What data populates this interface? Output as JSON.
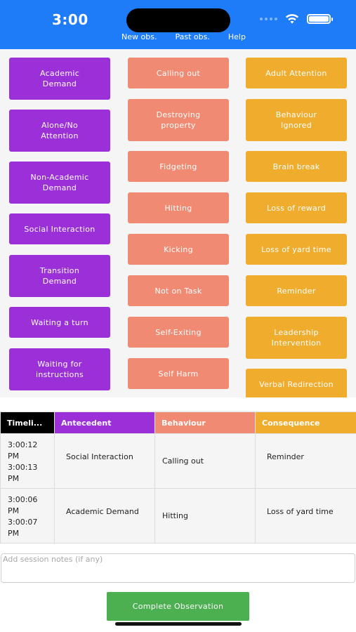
{
  "status": {
    "time": "3:00"
  },
  "nav": [
    "New obs.",
    "Past obs.",
    "Help"
  ],
  "antecedents": [
    "Academic\nDemand",
    "Alone/No\nAttention",
    "Non-Academic\nDemand",
    "Social Interaction",
    "Transition\nDemand",
    "Waiting a turn",
    "Waiting for\ninstructions"
  ],
  "behaviours": [
    "Calling out",
    "Destroying\nproperty",
    "Fidgeting",
    "Hitting",
    "Kicking",
    "Not on Task",
    "Self-Exiting",
    "Self Harm"
  ],
  "consequences": [
    "Adult Attention",
    "Behaviour\nIgnored",
    "Brain break",
    "Loss of reward",
    "Loss of yard time",
    "Reminder",
    "Leadership\nIntervention",
    "Verbal Redirection"
  ],
  "table": {
    "headers": {
      "time": "Timeli...",
      "antecedent": "Antecedent",
      "behaviour": "Behaviour",
      "consequence": "Consequence"
    },
    "rows": [
      {
        "start": "3:00:12\nPM",
        "end": "3:00:13\nPM",
        "antecedent": "Social Interaction",
        "behaviour": "Calling out",
        "consequence": "Reminder"
      },
      {
        "start": "3:00:06\nPM",
        "end": "3:00:07\nPM",
        "antecedent": "Academic Demand",
        "behaviour": "Hitting",
        "consequence": "Loss of yard time"
      }
    ]
  },
  "notes": {
    "placeholder": "Add session notes (if any)",
    "value": ""
  },
  "complete_label": "Complete Observation",
  "colors": {
    "header": "#1e7cf8",
    "antecedent": "#9b30d9",
    "behaviour": "#f08a72",
    "consequence": "#f0ac2d",
    "complete": "#4caf50"
  }
}
